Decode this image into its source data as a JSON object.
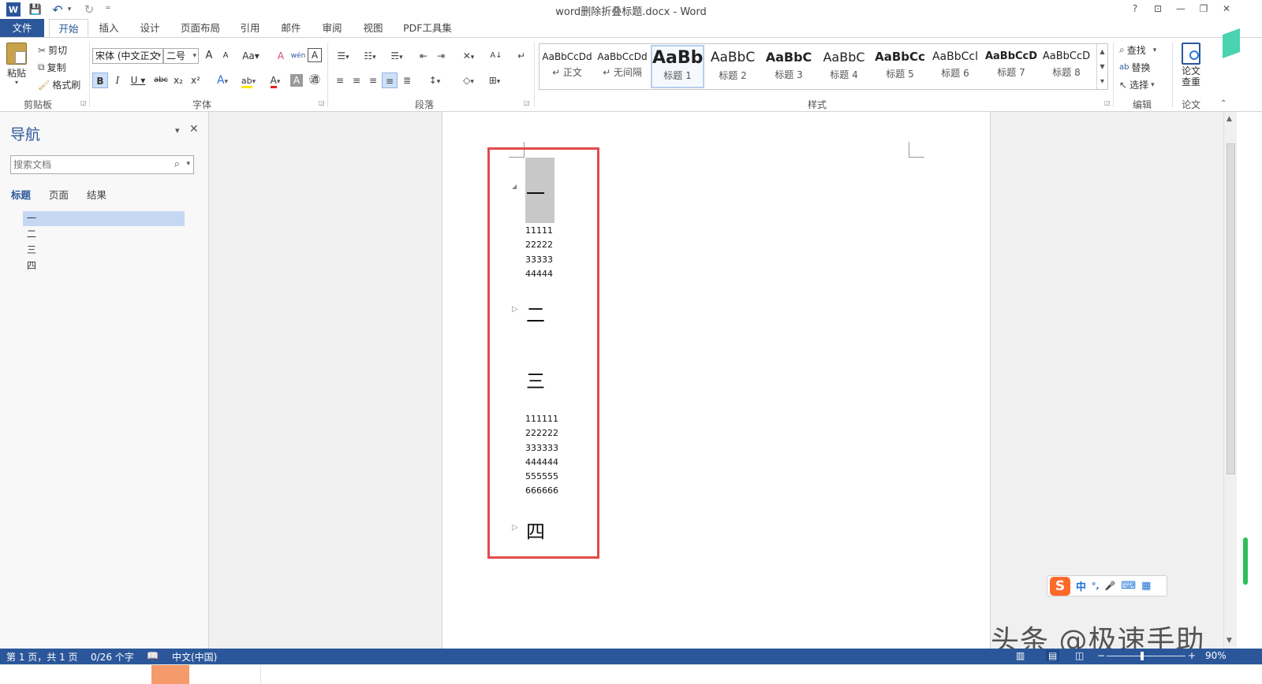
{
  "window": {
    "title": "word删除折叠标题.docx - Word",
    "help": "?",
    "ribbon_display": "⊡",
    "minimize": "—",
    "restore": "❐",
    "close": "✕"
  },
  "quick_access": {
    "app_icon": "W",
    "save": "💾",
    "undo": "↶",
    "undo_dd": "▾",
    "redo": "↻",
    "customize": "⁼"
  },
  "tabs": [
    "文件",
    "开始",
    "插入",
    "设计",
    "页面布局",
    "引用",
    "邮件",
    "审阅",
    "视图",
    "PDF工具集"
  ],
  "clipboard": {
    "paste": "粘贴",
    "paste_dd": "▾",
    "cut": "剪切",
    "copy": "复制",
    "format_painter": "格式刷",
    "label": "剪贴板"
  },
  "font": {
    "name": "宋体 (中文正文",
    "size": "二号",
    "grow": "A",
    "shrink": "A",
    "case": "Aa",
    "clear": "A",
    "phonetic": "wén",
    "border": "A",
    "bold": "B",
    "italic": "I",
    "underline": "U",
    "strike": "abc",
    "sub": "x₂",
    "sup": "x²",
    "effects": "A",
    "highlight": "ab",
    "color": "A",
    "shading": "A",
    "enclose": "㊜",
    "label": "字体"
  },
  "paragraph": {
    "bullets": "☰",
    "numbering": "☷",
    "multilevel": "☴",
    "dec_indent": "⇤",
    "inc_indent": "⇥",
    "asian_layout": "✕",
    "sort": "A↓",
    "show_marks": "↵",
    "align_left": "≡",
    "center": "≡",
    "align_right": "≡",
    "justify": "≡",
    "distribute": "≣",
    "line_spacing": "↕",
    "shading": "◇",
    "borders": "⊞",
    "label": "段落"
  },
  "styles": {
    "items": [
      {
        "sample": "AaBbCcDd",
        "name": "↵ 正文"
      },
      {
        "sample": "AaBbCcDd",
        "name": "↵ 无间隔"
      },
      {
        "sample": "AaBb",
        "name": "标题 1"
      },
      {
        "sample": "AaBbC",
        "name": "标题 2"
      },
      {
        "sample": "AaBbC",
        "name": "标题 3"
      },
      {
        "sample": "AaBbC",
        "name": "标题 4"
      },
      {
        "sample": "AaBbCc",
        "name": "标题 5"
      },
      {
        "sample": "AaBbCcl",
        "name": "标题 6"
      },
      {
        "sample": "AaBbCcD",
        "name": "标题 7"
      },
      {
        "sample": "AaBbCcD",
        "name": "标题 8"
      }
    ],
    "scroll_up": "▲",
    "scroll_down": "▼",
    "more": "▾",
    "label": "样式"
  },
  "editing": {
    "find": "查找",
    "replace": "替换",
    "select": "选择",
    "label": "编辑"
  },
  "thesis": {
    "check": "论文\n查重",
    "label": "论文"
  },
  "navigation": {
    "title": "导航",
    "menu": "▾",
    "close": "✕",
    "search_placeholder": "搜索文档",
    "search_icon": "⌕",
    "search_dd": "▾",
    "tabs": [
      "标题",
      "页面",
      "结果"
    ],
    "headings": [
      "一",
      "二",
      "三",
      "四"
    ]
  },
  "document": {
    "heading1": "一",
    "heading2": "二",
    "heading3": "三",
    "heading4": "四",
    "expand_marker": "◢",
    "collapse_marker": "▷",
    "list1": [
      "11111",
      "22222",
      "33333",
      "44444"
    ],
    "list3": [
      "111111",
      "222222",
      "333333",
      "444444",
      "555555",
      "666666"
    ]
  },
  "ime": {
    "logo": "S",
    "mode": "中",
    "punct": "°,",
    "voice": "🎤",
    "keyboard": "⌨",
    "tools": "▦"
  },
  "scrollbar": {
    "up": "▲",
    "down": "▼"
  },
  "status": {
    "page": "第 1 页，共 1 页",
    "words": "0/26 个字",
    "proof": "📖",
    "language": "中文(中国)",
    "read_mode": "▥",
    "print_layout": "▤",
    "web_layout": "◫",
    "zoom_out": "−",
    "zoom_in": "+",
    "zoom": "90%"
  },
  "watermark": "头条 @极速手助"
}
